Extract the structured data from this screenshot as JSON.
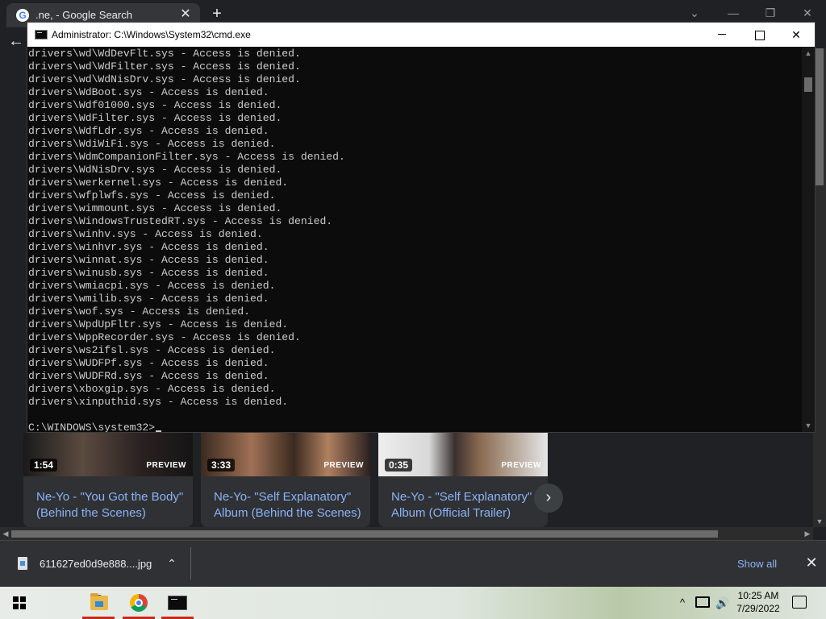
{
  "chrome": {
    "tab_title": ".ne, - Google Search",
    "tab_close": "✕",
    "new_tab": "+",
    "minimize": "—",
    "restore": "❐",
    "close": "✕",
    "back": "←"
  },
  "cards": [
    {
      "duration": "1:54",
      "preview": "PREVIEW",
      "title": "Ne-Yo - \"You Got the Body\" (Behind the Scenes)"
    },
    {
      "duration": "3:33",
      "preview": "PREVIEW",
      "title": "Ne-Yo- \"Self Explanatory\" Album (Behind the Scenes)"
    },
    {
      "duration": "0:35",
      "preview": "PREVIEW",
      "title": "Ne-Yo - \"Self Explanatory\" Album (Official Trailer)"
    }
  ],
  "card_next": "›",
  "download": {
    "filename": "611627ed0d9e888....jpg",
    "chevron": "⌃",
    "show_all": "Show all",
    "close": "✕"
  },
  "cmd": {
    "title": "Administrator: C:\\Windows\\System32\\cmd.exe",
    "output": [
      "drivers\\wd\\WdDevFlt.sys - Access is denied.",
      "drivers\\wd\\WdFilter.sys - Access is denied.",
      "drivers\\wd\\WdNisDrv.sys - Access is denied.",
      "drivers\\WdBoot.sys - Access is denied.",
      "drivers\\Wdf01000.sys - Access is denied.",
      "drivers\\WdFilter.sys - Access is denied.",
      "drivers\\WdfLdr.sys - Access is denied.",
      "drivers\\WdiWiFi.sys - Access is denied.",
      "drivers\\WdmCompanionFilter.sys - Access is denied.",
      "drivers\\WdNisDrv.sys - Access is denied.",
      "drivers\\werkernel.sys - Access is denied.",
      "drivers\\wfplwfs.sys - Access is denied.",
      "drivers\\wimmount.sys - Access is denied.",
      "drivers\\WindowsTrustedRT.sys - Access is denied.",
      "drivers\\winhv.sys - Access is denied.",
      "drivers\\winhvr.sys - Access is denied.",
      "drivers\\winnat.sys - Access is denied.",
      "drivers\\winusb.sys - Access is denied.",
      "drivers\\wmiacpi.sys - Access is denied.",
      "drivers\\wmilib.sys - Access is denied.",
      "drivers\\wof.sys - Access is denied.",
      "drivers\\WpdUpFltr.sys - Access is denied.",
      "drivers\\WppRecorder.sys - Access is denied.",
      "drivers\\ws2ifsl.sys - Access is denied.",
      "drivers\\WUDFPf.sys - Access is denied.",
      "drivers\\WUDFRd.sys - Access is denied.",
      "drivers\\xboxgip.sys - Access is denied.",
      "drivers\\xinputhid.sys - Access is denied."
    ],
    "prompt": "C:\\WINDOWS\\system32>",
    "close": "✕"
  },
  "taskbar": {
    "tray_up": "^",
    "volume": "🔊",
    "time": "10:25 AM",
    "date": "7/29/2022"
  },
  "colors": {
    "link": "#8ab4f8",
    "console_text": "#cccccc",
    "console_bg": "#0c0c0c",
    "chrome_bg": "#202124"
  }
}
